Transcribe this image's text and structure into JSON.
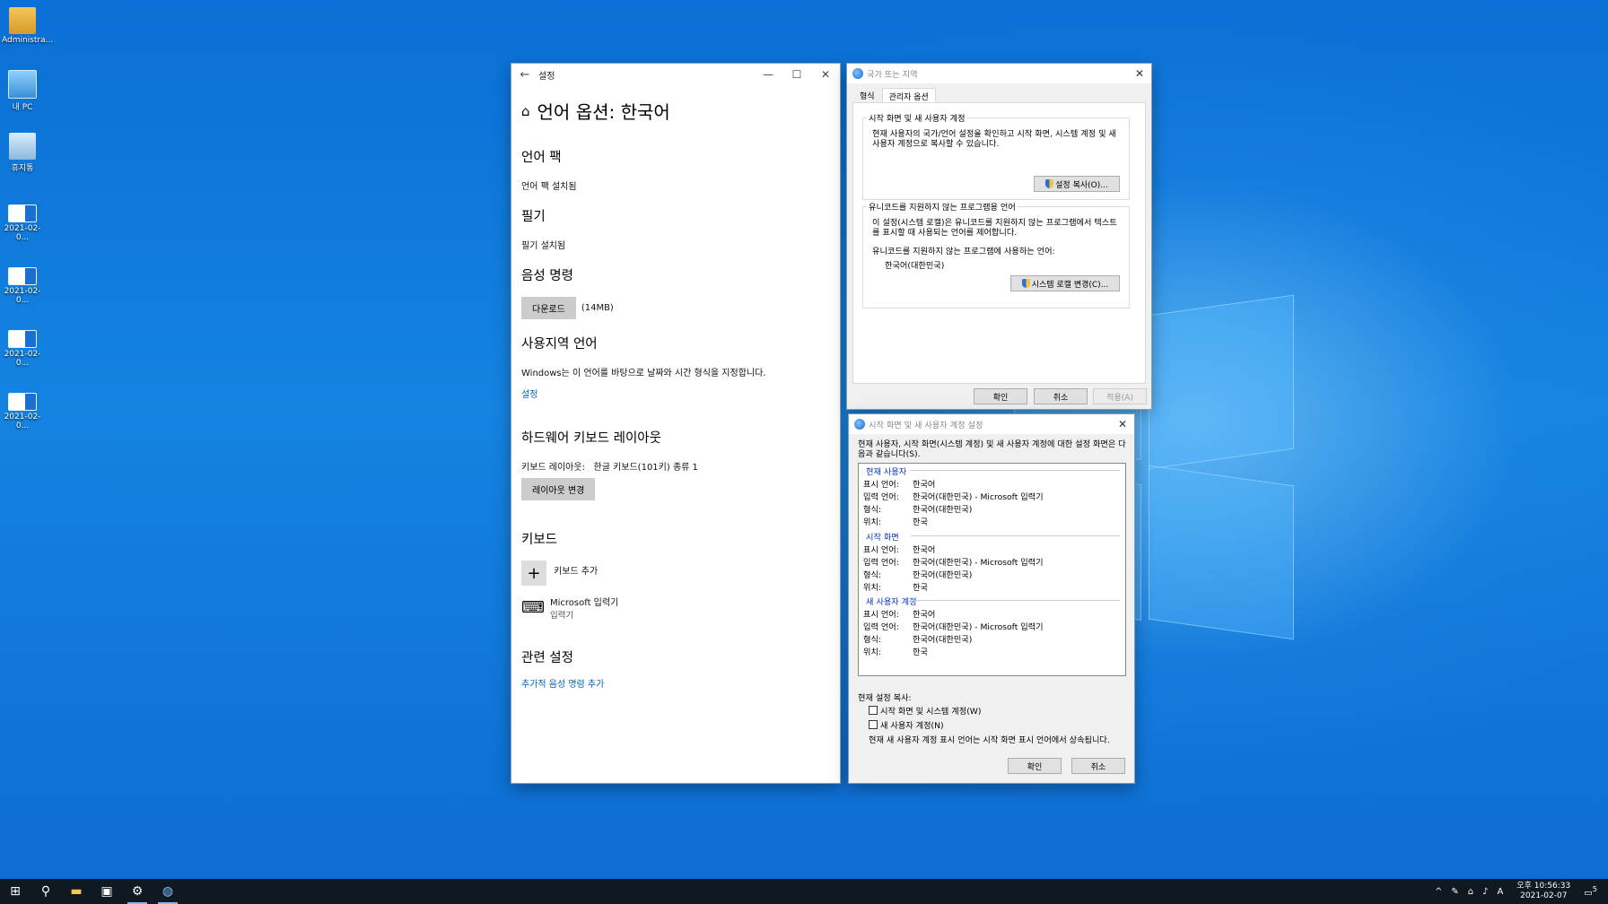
{
  "desktop": {
    "icons": [
      {
        "label": "Administra...",
        "icon": "user-folder-icon"
      },
      {
        "label": "내 PC",
        "icon": "pc-icon"
      },
      {
        "label": "휴지통",
        "icon": "recycle-bin-icon"
      },
      {
        "label": "2021-02-0...",
        "icon": "screenshot-file-icon"
      },
      {
        "label": "2021-02-0...",
        "icon": "screenshot-file-icon"
      },
      {
        "label": "2021-02-0...",
        "icon": "screenshot-file-icon"
      },
      {
        "label": "2021-02-0...",
        "icon": "screenshot-file-icon"
      }
    ]
  },
  "settings": {
    "title": "설정",
    "page_title": "언어 옵션: 한국어",
    "language_pack": {
      "heading": "언어 팩",
      "status": "언어 팩 설치됨"
    },
    "handwriting": {
      "heading": "필기",
      "status": "필기 설치됨"
    },
    "speech": {
      "heading": "음성 명령",
      "download_label": "다운로드",
      "size": "(14MB)"
    },
    "regional": {
      "heading": "사용지역 언어",
      "desc": "Windows는 이 언어를 바탕으로 날짜와 시간 형식을 지정합니다.",
      "link": "설정"
    },
    "hw_keyboard": {
      "heading": "하드웨어 키보드 레이아웃",
      "layout_label": "키보드 레이아웃:",
      "layout_value": "한글 키보드(101키) 종류 1",
      "change_label": "레이아웃 변경"
    },
    "keyboards": {
      "heading": "키보드",
      "add_label": "키보드 추가",
      "ime_name": "Microsoft 입력기",
      "ime_type": "입력기"
    },
    "related": {
      "heading": "관련 설정",
      "link": "추가적 음성 명령 추가"
    }
  },
  "region_dialog": {
    "title": "국가 또는 지역",
    "tabs": [
      "형식",
      "관리자 옵션"
    ],
    "active_tab": 1,
    "welcome_group": {
      "legend": "시작 화면 및 새 사용자 계정",
      "desc_line1": "현재 사용자의 국가/언어 설정을 확인하고 시작 화면, 시스템 계정 및 새",
      "desc_line2": "사용자 계정으로 복사할 수 있습니다.",
      "button": "설정 복사(O)..."
    },
    "nonunicode_group": {
      "legend": "유니코드를 지원하지 않는 프로그램용 언어",
      "desc_line1": "이 설정(시스템 로캘)은 유니코드를 지원하지 않는 프로그램에서 텍스트",
      "desc_line2": "를 표시할 때 사용되는 언어를 제어합니다.",
      "current_label": "유니코드를 지원하지 않는 프로그램에 사용하는 언어:",
      "current_value": "한국어(대한민국)",
      "button": "시스템 로캘 변경(C)..."
    },
    "ok": "확인",
    "cancel": "취소",
    "apply": "적용(A)"
  },
  "copy_dialog": {
    "title": "시작 화면 및 새 사용자 계정 설정",
    "intro_line1": "현재 사용자, 시작 화면(시스템 계정) 및 새 사용자 계정에 대한 설정 화면은 다",
    "intro_line2": "음과 같습니다(S).",
    "sections": [
      {
        "name": "현재 사용자",
        "rows": [
          [
            "표시 언어:",
            "한국어"
          ],
          [
            "입력 언어:",
            "한국어(대한민국) - Microsoft 입력기"
          ],
          [
            "형식:",
            "한국어(대한민국)"
          ],
          [
            "위치:",
            "한국"
          ]
        ]
      },
      {
        "name": "시작 화면",
        "rows": [
          [
            "표시 언어:",
            "한국어"
          ],
          [
            "입력 언어:",
            "한국어(대한민국) - Microsoft 입력기"
          ],
          [
            "형식:",
            "한국어(대한민국)"
          ],
          [
            "위치:",
            "한국"
          ]
        ]
      },
      {
        "name": "새 사용자 계정",
        "rows": [
          [
            "표시 언어:",
            "한국어"
          ],
          [
            "입력 언어:",
            "한국어(대한민국) - Microsoft 입력기"
          ],
          [
            "형식:",
            "한국어(대한민국)"
          ],
          [
            "위치:",
            "한국"
          ]
        ]
      }
    ],
    "copy_label": "현재 설정 복사:",
    "check1": "시작 화면 및 시스템 계정(W)",
    "check2": "새 사용자 계정(N)",
    "note": "현재 새 사용자 계정 표시 언어는 시작 화면 표시 언어에서 상속됩니다.",
    "ok": "확인",
    "cancel": "취소"
  },
  "taskbar": {
    "ime_indicator": "A",
    "time": "오후 10:56:33",
    "date": "2021-02-07",
    "notifications": "5"
  }
}
